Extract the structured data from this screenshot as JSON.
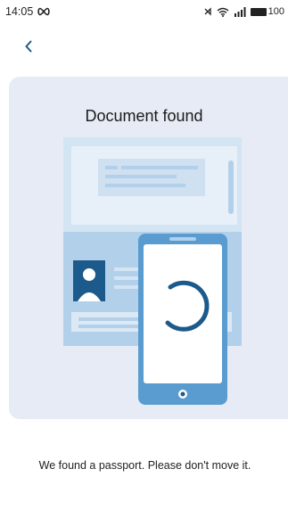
{
  "status_bar": {
    "time": "14:05",
    "infinity_icon": "infinity-icon",
    "bluetooth_icon": "bluetooth-icon",
    "wifi_icon": "wifi-icon",
    "signal_icon": "signal-icon",
    "battery_level": "100"
  },
  "header": {
    "back_icon": "chevron-left-icon"
  },
  "scan": {
    "title": "Document found",
    "message": "We found a passport. Please don't move it."
  },
  "colors": {
    "accent": "#1c5a8c",
    "card_bg": "#e6ebf5",
    "document_light": "#d3e4f3",
    "document_mid": "#b3d0ea",
    "phone_frame": "#5a9bd0"
  }
}
